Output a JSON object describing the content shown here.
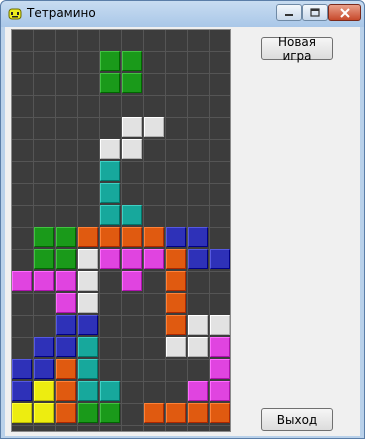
{
  "window": {
    "title": "Тетрамино"
  },
  "buttons": {
    "new_game": "Новая игра",
    "exit": "Выход"
  },
  "colors": {
    "G": "#1a9a1a",
    "W": "#e2e2e2",
    "T": "#17a89c",
    "O": "#e05a10",
    "B": "#2e31b8",
    "M": "#e044e0",
    "Y": "#eded10"
  },
  "grid": [
    "..........",
    "....GG....",
    "....GG....",
    "..........",
    ".....WW...",
    "....WW....",
    "....T.....",
    "....T.....",
    "....TT....",
    ".GGOOOOBB.",
    ".GGWMMMOBB",
    "MMMW.M.O..",
    "..MW...O..",
    "..BB...OWW",
    ".BBT...WWM",
    "BBOT.....M",
    "BYOTT...MM",
    "YYOGG.OOOO"
  ]
}
